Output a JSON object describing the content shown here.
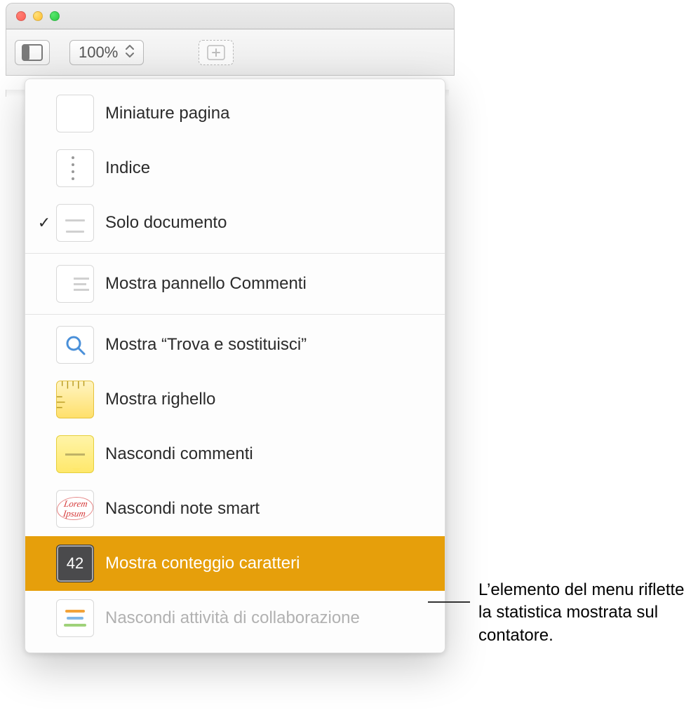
{
  "toolbar": {
    "zoom_value": "100%"
  },
  "menu": {
    "items": [
      {
        "label": "Miniature pagina",
        "checked": false,
        "highlighted": false,
        "disabled": false
      },
      {
        "label": "Indice",
        "checked": false,
        "highlighted": false,
        "disabled": false
      },
      {
        "label": "Solo documento",
        "checked": true,
        "highlighted": false,
        "disabled": false
      },
      {
        "label": "Mostra pannello Commenti",
        "checked": false,
        "highlighted": false,
        "disabled": false
      },
      {
        "label": "Mostra “Trova e sostituisci”",
        "checked": false,
        "highlighted": false,
        "disabled": false
      },
      {
        "label": "Mostra righello",
        "checked": false,
        "highlighted": false,
        "disabled": false
      },
      {
        "label": "Nascondi commenti",
        "checked": false,
        "highlighted": false,
        "disabled": false
      },
      {
        "label": "Nascondi note smart",
        "checked": false,
        "highlighted": false,
        "disabled": false
      },
      {
        "label": "Mostra conteggio caratteri",
        "checked": false,
        "highlighted": true,
        "disabled": false
      },
      {
        "label": "Nascondi attività di collaborazione",
        "checked": false,
        "highlighted": false,
        "disabled": true
      }
    ],
    "count_badge": "42",
    "lorem_badge": "Lorem Ipsum"
  },
  "callout": {
    "text": "L’elemento del menu riflette la statistica mostrata sul contatore."
  }
}
